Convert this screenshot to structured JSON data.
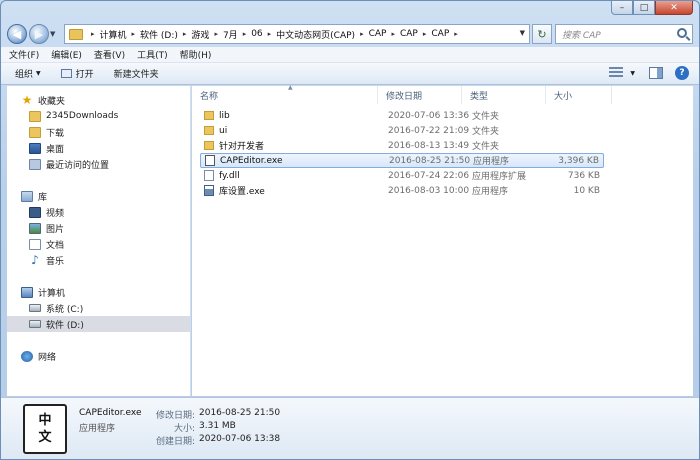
{
  "caption": {
    "minimize": "–",
    "maximize": "□",
    "close": "✕"
  },
  "nav": {
    "back": "◀",
    "forward": "▶",
    "history_drop": "▼",
    "refresh": "↻"
  },
  "address": {
    "crumbs": [
      "计算机",
      "软件 (D:)",
      "游戏",
      "7月",
      "06",
      "中文动态网页(CAP)",
      "CAP",
      "CAP",
      "CAP"
    ],
    "separator": "▸",
    "dropdown": "▼"
  },
  "search": {
    "placeholder": "搜索 CAP"
  },
  "menu": [
    "文件(F)",
    "编辑(E)",
    "查看(V)",
    "工具(T)",
    "帮助(H)"
  ],
  "toolbar": {
    "organize": "组织",
    "open": "打开",
    "new_folder": "新建文件夹",
    "drop": "▼",
    "help": "?"
  },
  "sidebar": {
    "favorites_header": "收藏夹",
    "favorites": [
      {
        "label": "2345Downloads",
        "icon": "folder-icon"
      },
      {
        "label": "下载",
        "icon": "folder-icon"
      },
      {
        "label": "桌面",
        "icon": "desktop-icon"
      },
      {
        "label": "最近访问的位置",
        "icon": "recent-places-icon"
      }
    ],
    "libraries_header": "库",
    "libraries": [
      {
        "label": "视频",
        "icon": "video-icon"
      },
      {
        "label": "图片",
        "icon": "picture-icon"
      },
      {
        "label": "文档",
        "icon": "document-icon"
      },
      {
        "label": "音乐",
        "icon": "music-icon"
      }
    ],
    "computer_header": "计算机",
    "drives": [
      {
        "label": "系统 (C:)",
        "icon": "drive-icon"
      },
      {
        "label": "软件 (D:)",
        "icon": "drive-icon"
      }
    ],
    "network_header": "网络"
  },
  "columns": {
    "name": "名称",
    "date": "修改日期",
    "type": "类型",
    "size": "大小",
    "sort": "▲"
  },
  "files": [
    {
      "name": "lib",
      "date": "2020-07-06 13:36",
      "type": "文件夹",
      "size": "",
      "icon": "folder-icon"
    },
    {
      "name": "ui",
      "date": "2016-07-22 21:09",
      "type": "文件夹",
      "size": "",
      "icon": "folder-icon"
    },
    {
      "name": "针对开发者",
      "date": "2016-08-13 13:49",
      "type": "文件夹",
      "size": "",
      "icon": "folder-icon"
    },
    {
      "name": "CAPEditor.exe",
      "date": "2016-08-25 21:50",
      "type": "应用程序",
      "size": "3,396 KB",
      "icon": "exe-icon"
    },
    {
      "name": "fy.dll",
      "date": "2016-07-24 22:06",
      "type": "应用程序扩展",
      "size": "736 KB",
      "icon": "dll-icon"
    },
    {
      "name": "库设置.exe",
      "date": "2016-08-03 10:00",
      "type": "应用程序",
      "size": "10 KB",
      "icon": "app-icon"
    }
  ],
  "details": {
    "icon_char_1": "中",
    "icon_char_2": "文",
    "name": "CAPEditor.exe",
    "type": "应用程序",
    "modified_label": "修改日期:",
    "modified": "2016-08-25 21:50",
    "size_label": "大小:",
    "size": "3.31 MB",
    "created_label": "创建日期:",
    "created": "2020-07-06 13:38"
  },
  "colors": {
    "accent": "#2d6fc2",
    "folder": "#eac65d",
    "selected_row": "#d6e8fb"
  }
}
